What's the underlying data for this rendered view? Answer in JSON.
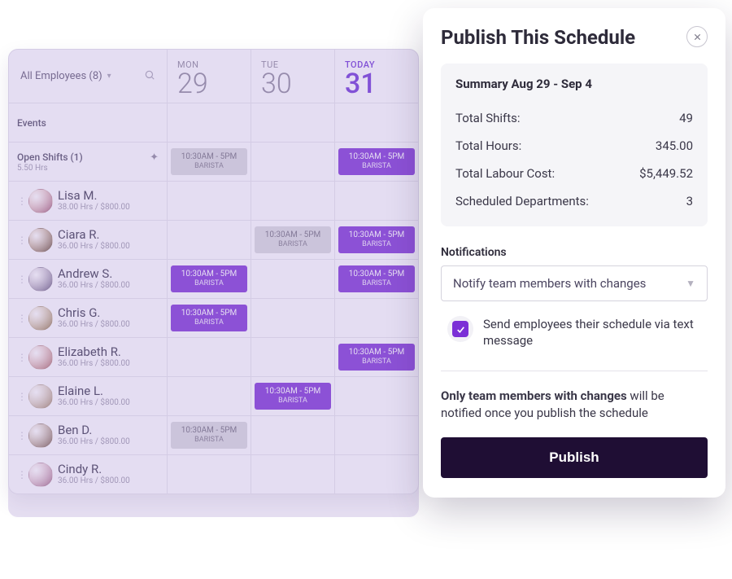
{
  "calendar": {
    "filter_label": "All Employees (8)",
    "days": [
      {
        "dow": "MON",
        "num": "29",
        "today": false
      },
      {
        "dow": "TUE",
        "num": "30",
        "today": false
      },
      {
        "dow": "TODAY",
        "num": "31",
        "today": true
      }
    ],
    "events_label": "Events",
    "open_shifts": {
      "label": "Open Shifts (1)",
      "sub": "5.50 Hrs"
    },
    "shift_common": {
      "time": "10:30AM - 5PM",
      "role": "BARISTA"
    },
    "employees": [
      {
        "name": "Lisa M.",
        "meta": "38.00 Hrs / $800.00",
        "a1": "#e9b1a0",
        "a2": "#9a4b6a",
        "cells": [
          "",
          "",
          ""
        ]
      },
      {
        "name": "Ciara R.",
        "meta": "36.00 Hrs / $800.00",
        "a1": "#c08b5a",
        "a2": "#5a3d2a",
        "cells": [
          "",
          "gray",
          "purple"
        ]
      },
      {
        "name": "Andrew S.",
        "meta": "36.00 Hrs / $800.00",
        "a1": "#b39fb8",
        "a2": "#5a4d73",
        "cells": [
          "purple",
          "",
          "purple"
        ]
      },
      {
        "name": "Chris G.",
        "meta": "36.00 Hrs / $800.00",
        "a1": "#d6b98a",
        "a2": "#8a6a3d",
        "cells": [
          "purple",
          "",
          ""
        ]
      },
      {
        "name": "Elizabeth R.",
        "meta": "36.00 Hrs / $800.00",
        "a1": "#e2a6a0",
        "a2": "#a55a5a",
        "cells": [
          "",
          "",
          "purple"
        ]
      },
      {
        "name": "Elaine L.",
        "meta": "36.00 Hrs / $800.00",
        "a1": "#d8c4b0",
        "a2": "#9a7a5a",
        "cells": [
          "",
          "purple",
          ""
        ]
      },
      {
        "name": "Ben D.",
        "meta": "36.00 Hrs / $800.00",
        "a1": "#c0a080",
        "a2": "#6a4a3a",
        "cells": [
          "gray",
          "",
          ""
        ]
      },
      {
        "name": "Cindy R.",
        "meta": "36.00 Hrs / $800.00",
        "a1": "#e5b4c0",
        "a2": "#9a5a7a",
        "cells": [
          "",
          "",
          ""
        ]
      }
    ]
  },
  "modal": {
    "title": "Publish This Schedule",
    "summary": {
      "title": "Summary Aug 29 - Sep 4",
      "rows": [
        {
          "label": "Total Shifts:",
          "value": "49"
        },
        {
          "label": "Total Hours:",
          "value": "345.00"
        },
        {
          "label": "Total Labour Cost:",
          "value": "$5,449.52"
        },
        {
          "label": "Scheduled Departments:",
          "value": "3"
        }
      ]
    },
    "notifications": {
      "section_label": "Notifications",
      "select_value": "Notify team members with changes",
      "checkbox_label": "Send employees their schedule via text message"
    },
    "notice_bold": "Only team members with changes",
    "notice_rest": " will be notified once you publish the schedule",
    "publish_label": "Publish"
  }
}
